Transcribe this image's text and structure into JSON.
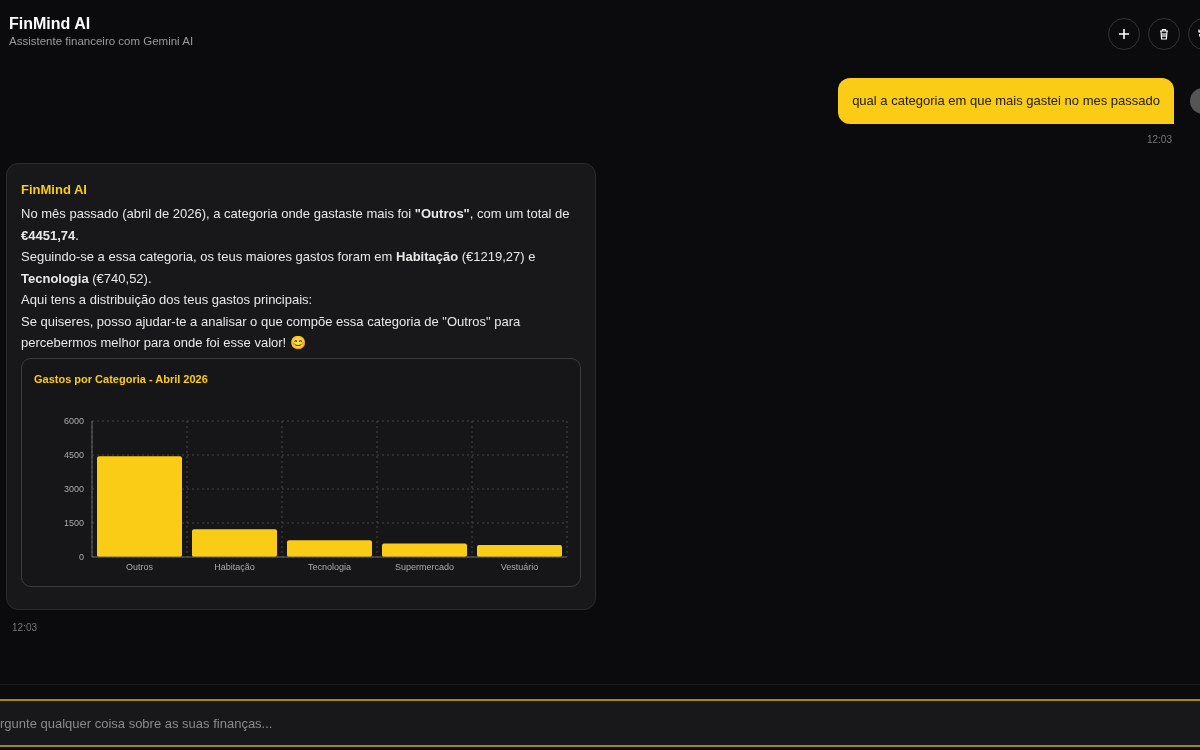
{
  "header": {
    "title": "FinMind AI",
    "subtitle": "Assistente financeiro com Gemini AI",
    "buttons": [
      {
        "kind": "new"
      },
      {
        "kind": "delete"
      },
      {
        "kind": "history"
      }
    ]
  },
  "messages": [
    {
      "kind": "user",
      "text": "qual a categoria em que mais gastei no mes passado",
      "time": "12:03"
    },
    {
      "kind": "assistant",
      "sender": "FinMind AI",
      "paragraphs": [
        "No mês passado (abril de 2026), a categoria onde gastaste mais foi **\"Outros\"**, com um total de **€4451,74**.",
        "Seguindo-se a essa categoria, os teus maiores gastos foram em **Habitação** (€1219,27) e **Tecnologia** (€740,52).",
        "Aqui tens a distribuição dos teus gastos principais:",
        "Se quiseres, posso ajudar-te a analisar o que compõe essa categoria de \"Outros\" para percebermos melhor para onde foi esse valor! 😊"
      ],
      "chart_data": {
        "type": "bar",
        "title": "Gastos por Categoria - Abril 2026",
        "categories": [
          "Outros",
          "Habitação",
          "Tecnologia",
          "Supermercado",
          "Vestuário"
        ],
        "series": [
          {
            "color": "#facc15",
            "values": [
              4450,
              1220,
              740,
              600,
              530
            ]
          }
        ],
        "grid": true,
        "ylim": [
          0,
          6000
        ],
        "yticks": [
          0,
          1500,
          3000,
          4500,
          6000
        ]
      },
      "time": "12:03"
    }
  ],
  "input": {
    "placeholder": "rgunte qualquer coisa sobre as suas finanças..."
  }
}
